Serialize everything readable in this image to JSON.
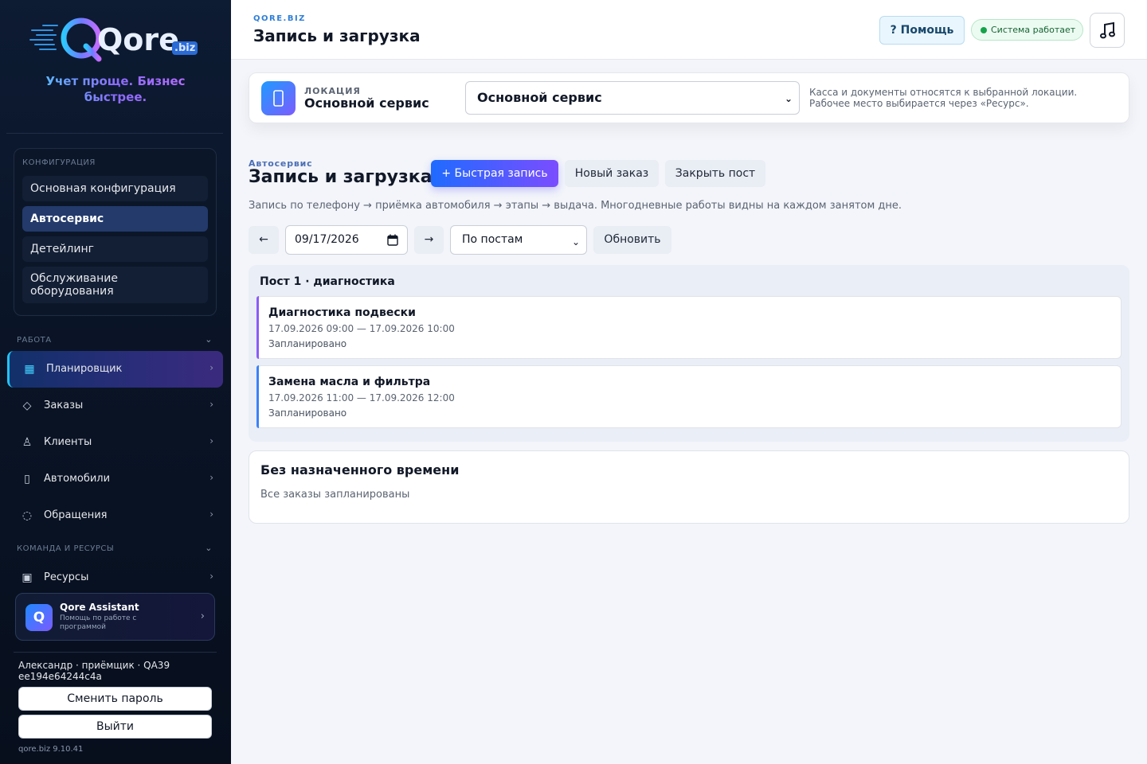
{
  "sidebar": {
    "logo": {
      "word": "Qore",
      "suffix": ".biz"
    },
    "tagline": "Учет проще. Бизнес быстрее.",
    "config": {
      "title": "КОНФИГУРАЦИЯ",
      "items": [
        {
          "label": "Основная конфигурация",
          "active": false
        },
        {
          "label": "Автосервис",
          "active": true
        },
        {
          "label": "Детейлинг",
          "active": false
        },
        {
          "label": "Обслуживание оборудования",
          "active": false
        }
      ]
    },
    "sections": [
      {
        "title": "РАБОТА",
        "chevron": "⌄"
      },
      {
        "title": "КОМАНДА И РЕСУРСЫ",
        "chevron": "⌄"
      }
    ],
    "nav": [
      {
        "label": "Планировщик",
        "icon": "grid-icon",
        "glyph": "▦",
        "active": true
      },
      {
        "label": "Заказы",
        "icon": "diamond-icon",
        "glyph": "◇",
        "active": false
      },
      {
        "label": "Клиенты",
        "icon": "user-icon",
        "glyph": "♙",
        "active": false
      },
      {
        "label": "Автомобили",
        "icon": "car-icon",
        "glyph": "▯",
        "active": false
      },
      {
        "label": "Обращения",
        "icon": "chat-icon",
        "glyph": "◌",
        "active": false
      },
      {
        "label": "Ресурсы",
        "icon": "resource-icon",
        "glyph": "▣",
        "active": false
      }
    ],
    "nav_arrow": "›",
    "assistant": {
      "badge": "Q",
      "title": "Qore Assistant",
      "subtitle": "Помощь по работе с программой",
      "arrow": "›"
    },
    "user": "Александр · приёмщик · QA39 ee194e64244c4a",
    "change_password": "Сменить пароль",
    "logout": "Выйти",
    "version": "qore.biz 9.10.41"
  },
  "header": {
    "brand": "QORE.BIZ",
    "title": "Запись и загрузка",
    "help": "? Помощь",
    "status": "Система работает",
    "music_icon": "music-note-icon"
  },
  "location": {
    "icon": "location-icon",
    "label": "ЛОКАЦИЯ",
    "name": "Основной сервис",
    "selected": "Основной сервис",
    "note": "Касса и документы относятся к выбранной локации. Рабочее место выбирается через «Ресурс»."
  },
  "section": {
    "kicker": "Автосервис",
    "title": "Запись и загрузка",
    "quick_booking": "+ Быстрая запись",
    "new_order": "Новый заказ",
    "close_post": "Закрыть пост",
    "description": "Запись по телефону → приёмка автомобиля → этапы → выдача. Многодневные работы видны на каждом занятом дне."
  },
  "controls": {
    "prev": "←",
    "date": "09/17/2026",
    "next": "→",
    "view": "По постам",
    "refresh": "Обновить"
  },
  "posts": [
    {
      "title": "Пост 1 · диагностика",
      "jobs": [
        {
          "name": "Диагностика подвески",
          "time": "17.09.2026 09:00 — 17.09.2026 10:00",
          "status": "Запланировано",
          "color": "#8b5cf6"
        },
        {
          "name": "Замена масла и фильтра",
          "time": "17.09.2026 11:00 — 17.09.2026 12:00",
          "status": "Запланировано",
          "color": "#3b82f6"
        }
      ]
    }
  ],
  "unscheduled": {
    "title": "Без назначенного времени",
    "text": "Все заказы запланированы"
  },
  "colors": {
    "accent": "#1f6bff",
    "accent2": "#7b4dff",
    "sidebar": "#0a1426",
    "success": "#16a34a"
  }
}
